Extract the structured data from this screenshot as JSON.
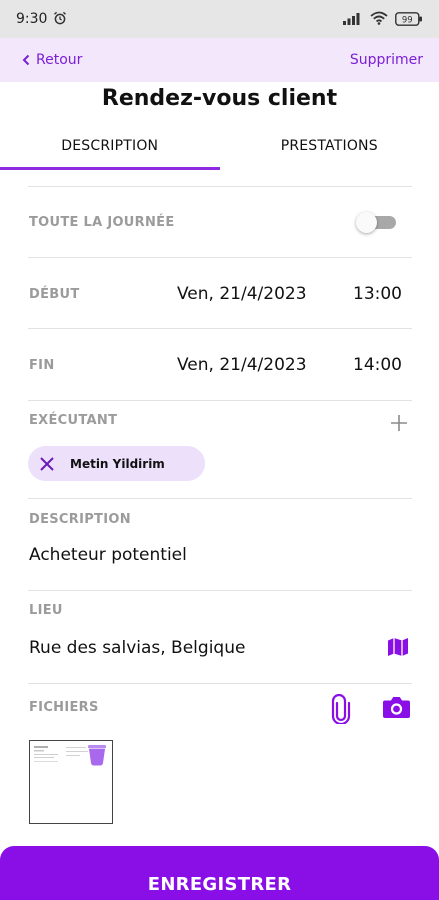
{
  "status_bar": {
    "time": "9:30",
    "battery": "99"
  },
  "header": {
    "back_label": "Retour",
    "delete_label": "Supprimer",
    "title": "Rendez-vous client"
  },
  "tabs": [
    {
      "label": "DESCRIPTION",
      "active": true
    },
    {
      "label": "PRESTATIONS",
      "active": false
    }
  ],
  "form": {
    "all_day": {
      "label": "TOUTE LA JOURNÉE",
      "value": false
    },
    "start": {
      "label": "DÉBUT",
      "date": "Ven, 21/4/2023",
      "time": "13:00"
    },
    "end": {
      "label": "FIN",
      "date": "Ven, 21/4/2023",
      "time": "14:00"
    },
    "executor": {
      "label": "EXÉCUTANT",
      "people": [
        "Metin Yildirim"
      ]
    },
    "description": {
      "label": "DESCRIPTION",
      "value": "Acheteur potentiel"
    },
    "location": {
      "label": "LIEU",
      "value": "Rue des salvias, Belgique"
    },
    "files": {
      "label": "FICHIERS"
    }
  },
  "save_label": "ENREGISTRER",
  "colors": {
    "accent": "#8a0fe6",
    "header_bg": "#f3e8fb",
    "chip_bg": "#ede0fa",
    "label_gray": "#9b9b9b"
  }
}
